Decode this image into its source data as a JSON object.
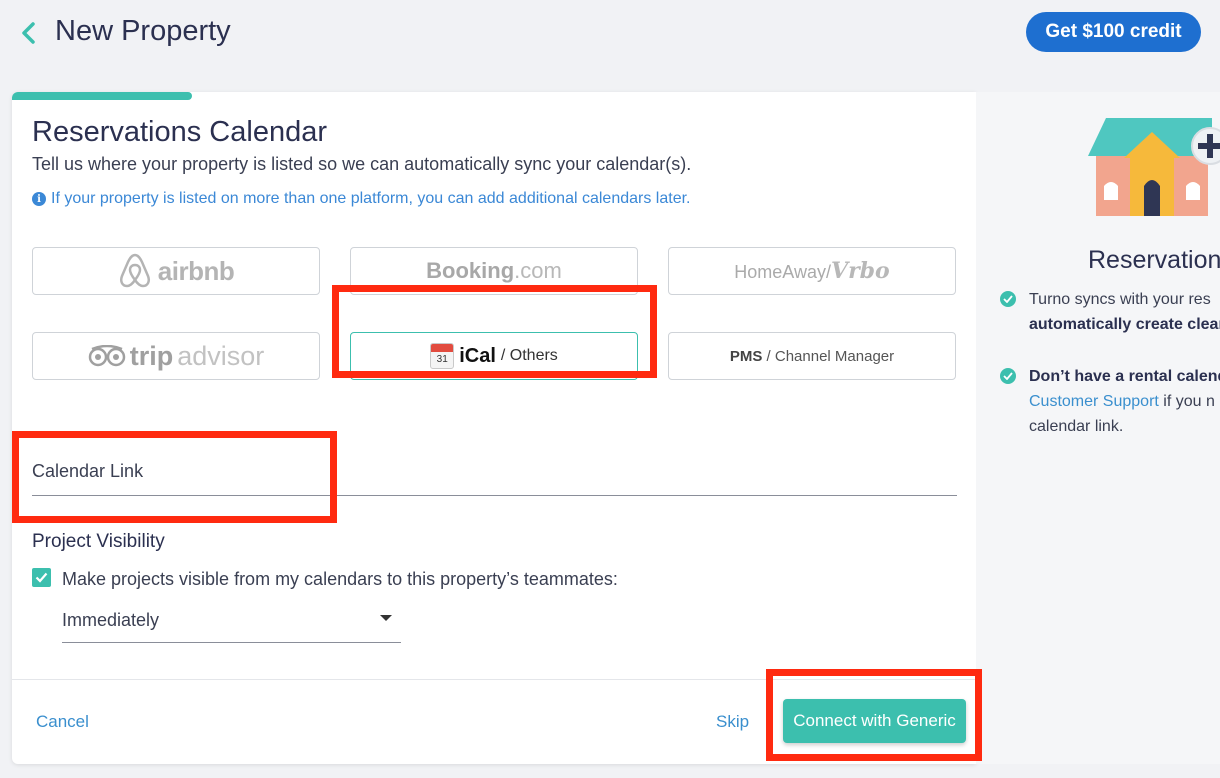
{
  "header": {
    "title": "New Property",
    "credit_button": "Get $100 credit"
  },
  "main": {
    "section_title": "Reservations Calendar",
    "subtitle": "Tell us where your property is listed so we can automatically sync your calendar(s).",
    "info": "If your property is listed on more than one platform, you can add additional calendars later.",
    "platforms": {
      "airbnb": "airbnb",
      "booking_main": "Booking",
      "booking_tld": ".com",
      "homeaway": "HomeAway/",
      "vrbo": "Vrbo",
      "trip_bold": "trip",
      "trip_light": "advisor",
      "ical_day": "31",
      "ical": "iCal",
      "ical_rest": "/ Others",
      "pms": "PMS",
      "pms_rest": " / Channel Manager"
    },
    "selected_platform": "ical",
    "calendar_link_label": "Calendar Link",
    "visibility": {
      "title": "Project Visibility",
      "checkbox_label": "Make projects visible from my calendars to this property’s teammates:",
      "checked": true,
      "select_value": "Immediately"
    },
    "footer": {
      "cancel": "Cancel",
      "skip": "Skip",
      "connect": "Connect with Generic"
    }
  },
  "side": {
    "title": "Reservation",
    "row1_line1": "Turno syncs with your res",
    "row1_line2": "automatically create clear",
    "row2_line1": "Don’t have a rental calend",
    "row2_link": "Customer Support",
    "row2_line2_rest": " if you n",
    "row2_line3": "calendar link."
  },
  "colors": {
    "accent": "#3cbfae",
    "primary_blue": "#1e6fd0",
    "link": "#3a8fce",
    "highlight": "#ff2a10"
  }
}
